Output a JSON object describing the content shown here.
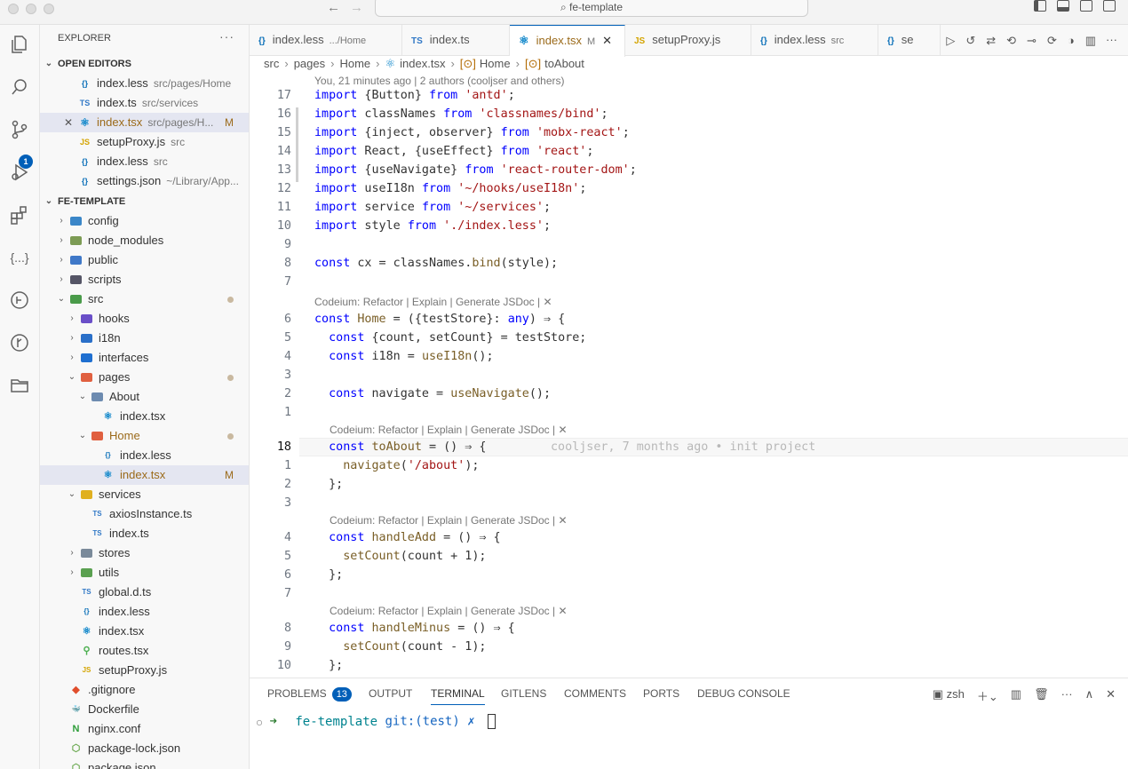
{
  "window": {
    "title": "fe-template"
  },
  "activity_badge": "1",
  "explorer": {
    "title": "EXPLORER",
    "more": "···",
    "open_editors_header": "OPEN EDITORS",
    "open_editors": [
      {
        "name": "index.less",
        "desc": "src/pages/Home",
        "icon": "{}"
      },
      {
        "name": "index.ts",
        "desc": "src/services",
        "icon": "TS"
      },
      {
        "name": "index.tsx",
        "desc": "src/pages/H...",
        "icon": "⚛",
        "flag": "M",
        "close": "✕"
      },
      {
        "name": "setupProxy.js",
        "desc": "src",
        "icon": "JS"
      },
      {
        "name": "index.less",
        "desc": "src",
        "icon": "{}"
      },
      {
        "name": "settings.json",
        "desc": "~/Library/App...",
        "icon": "{}"
      }
    ],
    "project_header": "FE-TEMPLATE",
    "tree": [
      {
        "name": "config",
        "chev": "›"
      },
      {
        "name": "node_modules",
        "chev": "›"
      },
      {
        "name": "public",
        "chev": "›"
      },
      {
        "name": "scripts",
        "chev": "›"
      },
      {
        "name": "src",
        "chev": "⌄"
      },
      {
        "name": "hooks",
        "chev": "›"
      },
      {
        "name": "i18n",
        "chev": "›"
      },
      {
        "name": "interfaces",
        "chev": "›"
      },
      {
        "name": "pages",
        "chev": "⌄"
      },
      {
        "name": "About",
        "chev": "⌄"
      },
      {
        "name": "index.tsx",
        "chev": ""
      },
      {
        "name": "Home",
        "chev": "⌄"
      },
      {
        "name": "index.less",
        "chev": ""
      },
      {
        "name": "index.tsx",
        "chev": "",
        "flag": "M"
      },
      {
        "name": "services",
        "chev": "⌄"
      },
      {
        "name": "axiosInstance.ts",
        "chev": ""
      },
      {
        "name": "index.ts",
        "chev": ""
      },
      {
        "name": "stores",
        "chev": "›"
      },
      {
        "name": "utils",
        "chev": "›"
      },
      {
        "name": "global.d.ts",
        "chev": ""
      },
      {
        "name": "index.less",
        "chev": ""
      },
      {
        "name": "index.tsx",
        "chev": ""
      },
      {
        "name": "routes.tsx",
        "chev": ""
      },
      {
        "name": "setupProxy.js",
        "chev": ""
      },
      {
        "name": ".gitignore",
        "chev": ""
      },
      {
        "name": "Dockerfile",
        "chev": ""
      },
      {
        "name": "nginx.conf",
        "chev": ""
      },
      {
        "name": "package-lock.json",
        "chev": ""
      },
      {
        "name": "package.json",
        "chev": ""
      }
    ]
  },
  "tabs": [
    {
      "name": "index.less",
      "desc": ".../Home",
      "icon": "{}"
    },
    {
      "name": "index.ts",
      "desc": "",
      "icon": "TS"
    },
    {
      "name": "index.tsx",
      "desc": "M",
      "icon": "⚛",
      "close": "✕"
    },
    {
      "name": "setupProxy.js",
      "desc": "",
      "icon": "JS"
    },
    {
      "name": "index.less",
      "desc": "src",
      "icon": "{}"
    },
    {
      "name": "se",
      "desc": "",
      "icon": "{}"
    }
  ],
  "breadcrumb": [
    "src",
    "pages",
    "Home",
    "index.tsx",
    "Home",
    "toAbout"
  ],
  "blame_header": "You, 21 minutes ago | 2 authors (cooljser and others)",
  "lens_text": "Codeium: Refactor | Explain | Generate JSDoc | ✕",
  "code_lines": [
    {
      "n": "17",
      "t": "import {Button} from 'antd';"
    },
    {
      "n": "16",
      "t": "import classNames from 'classnames/bind';"
    },
    {
      "n": "15",
      "t": "import {inject, observer} from 'mobx-react';"
    },
    {
      "n": "14",
      "t": "import React, {useEffect} from 'react';"
    },
    {
      "n": "13",
      "t": "import {useNavigate} from 'react-router-dom';"
    },
    {
      "n": "12",
      "t": "import useI18n from '~/hooks/useI18n';"
    },
    {
      "n": "11",
      "t": "import service from '~/services';"
    },
    {
      "n": "10",
      "t": "import style from './index.less';"
    },
    {
      "n": "9",
      "t": ""
    },
    {
      "n": "8",
      "t": "const cx = classNames.bind(style);"
    },
    {
      "n": "7",
      "t": ""
    },
    {
      "n": "6",
      "t": "const Home = ({testStore}: any) ⇒ {"
    },
    {
      "n": "5",
      "t": "  const {count, setCount} = testStore;"
    },
    {
      "n": "4",
      "t": "  const i18n = useI18n();"
    },
    {
      "n": "3",
      "t": ""
    },
    {
      "n": "2",
      "t": "  const navigate = useNavigate();"
    },
    {
      "n": "1",
      "t": ""
    },
    {
      "n": "18",
      "t": "  const toAbout = () ⇒ {"
    },
    {
      "n": "1",
      "t": "    navigate('/about');"
    },
    {
      "n": "2",
      "t": "  };"
    },
    {
      "n": "3",
      "t": ""
    },
    {
      "n": "4",
      "t": "  const handleAdd = () ⇒ {"
    },
    {
      "n": "5",
      "t": "    setCount(count + 1);"
    },
    {
      "n": "6",
      "t": "  };"
    },
    {
      "n": "7",
      "t": ""
    },
    {
      "n": "8",
      "t": "  const handleMinus = () ⇒ {"
    },
    {
      "n": "9",
      "t": "    setCount(count - 1);"
    },
    {
      "n": "10",
      "t": "  };"
    }
  ],
  "inline_blame": "cooljser, 7 months ago • init project",
  "panel": {
    "tabs": [
      "PROBLEMS",
      "OUTPUT",
      "TERMINAL",
      "GITLENS",
      "COMMENTS",
      "PORTS",
      "DEBUG CONSOLE"
    ],
    "problems_count": "13",
    "shell": "zsh",
    "prompt_dir": "fe-template",
    "prompt_git": "git:(test) ✗"
  },
  "colors": {
    "accent": "#005fb8",
    "modified": "#9b6a1a"
  }
}
